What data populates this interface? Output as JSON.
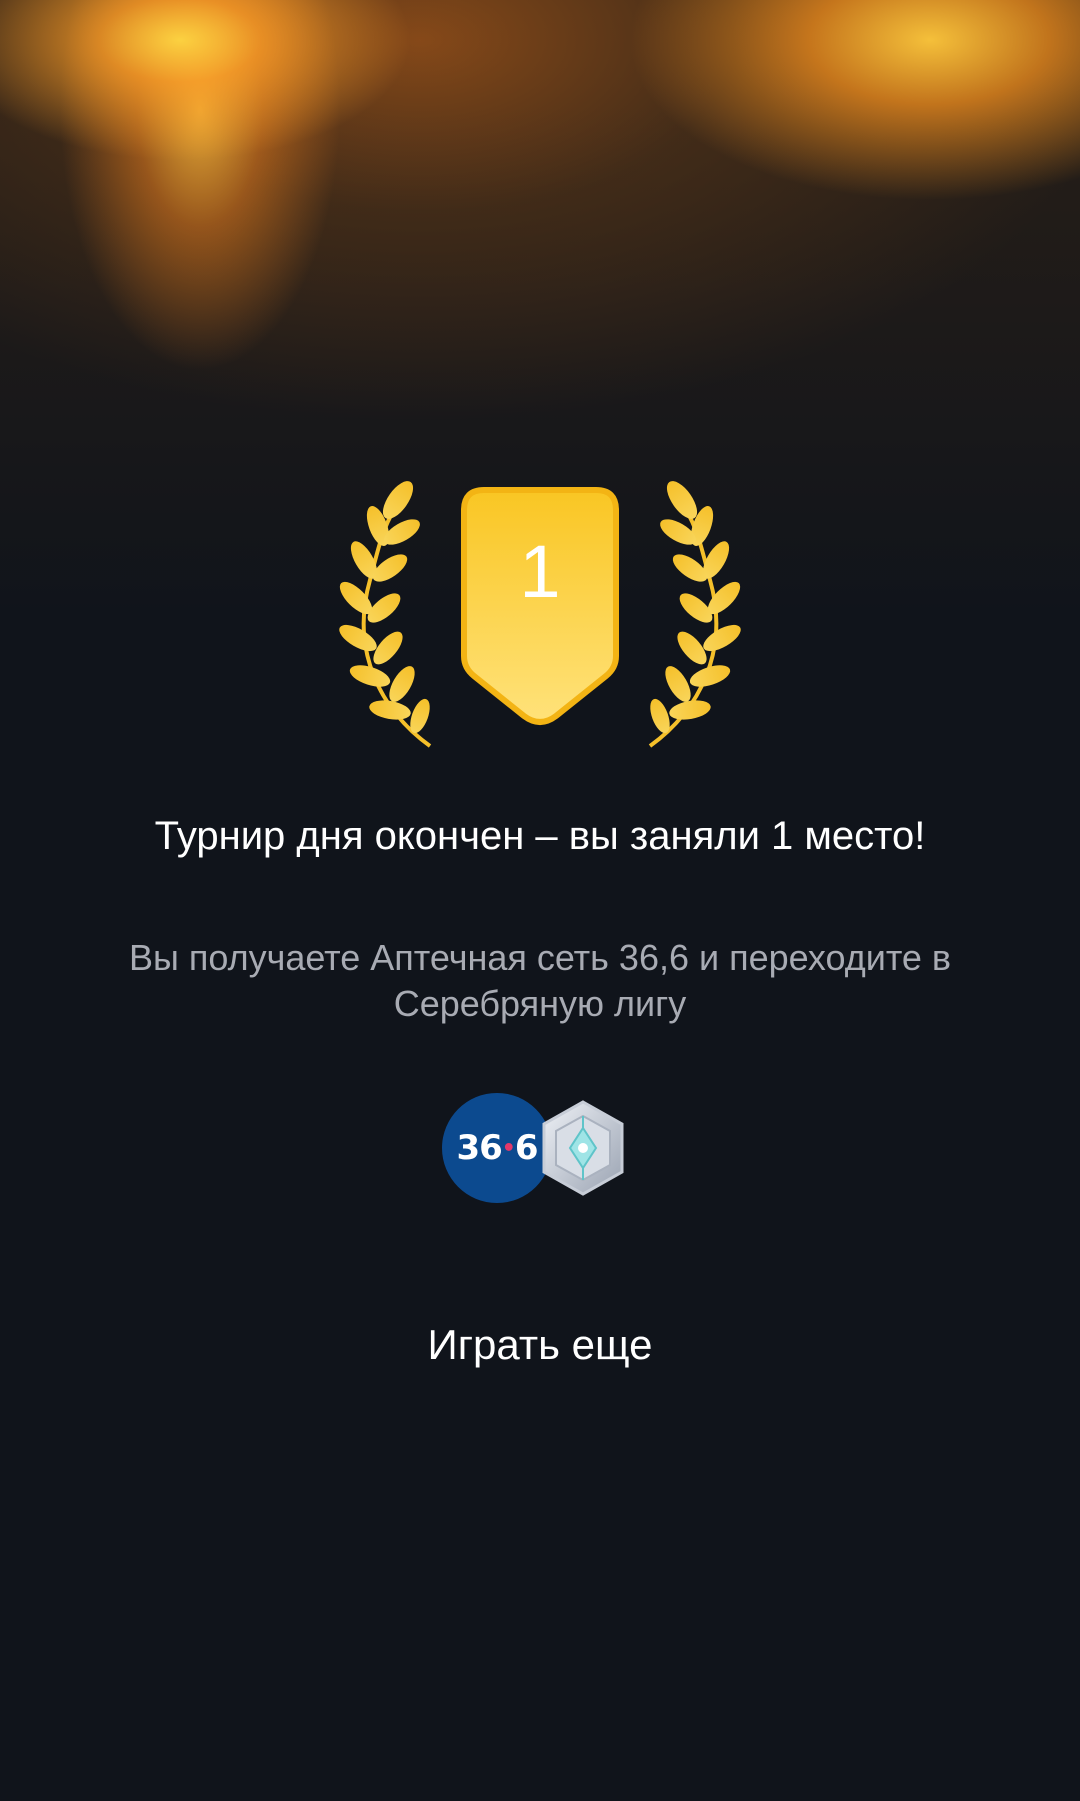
{
  "result": {
    "place": "1",
    "title": "Турнир дня окончен – вы заняли 1 место!",
    "subtitle": "Вы получаете Аптечная сеть 36,6 и переходите в Серебряную лигу"
  },
  "rewards": {
    "pharmacy_logo_left": "36",
    "pharmacy_logo_dot": "•",
    "pharmacy_logo_right": "6",
    "pharmacy_logo_color": "#0c4a8f",
    "league_icon": "silver-league-badge"
  },
  "actions": {
    "play_again_label": "Играть еще"
  },
  "colors": {
    "background": "#10141b",
    "gold": "#f7c21a",
    "subtitle": "#a8abb3"
  }
}
